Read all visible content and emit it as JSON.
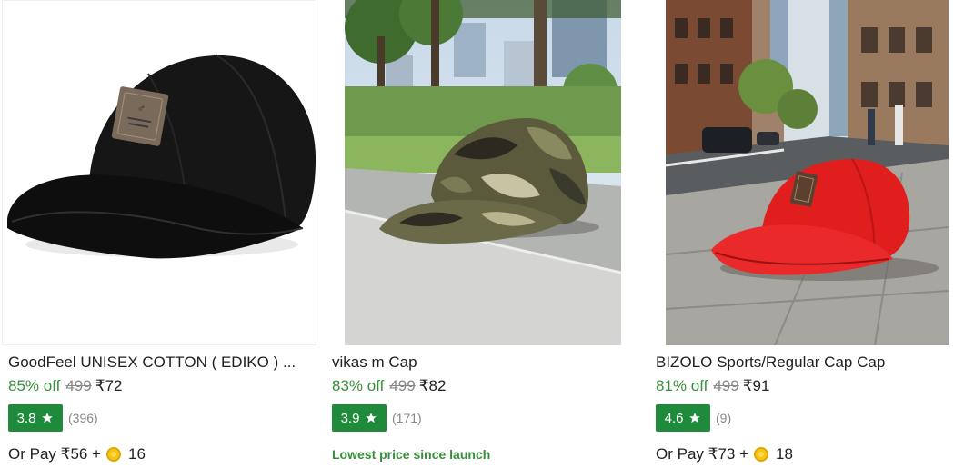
{
  "products": [
    {
      "title": "GoodFeel UNISEX COTTON ( EDIKO ) ...",
      "discount": "85% off",
      "mrp": "499",
      "price": "₹72",
      "rating": "3.8",
      "rating_count": "(396)",
      "pay_text": "Or Pay ₹56 +",
      "coins": "16",
      "image_icon": "black-cap-image"
    },
    {
      "title": "vikas m Cap",
      "discount": "83% off",
      "mrp": "499",
      "price": "₹82",
      "rating": "3.9",
      "rating_count": "(171)",
      "promo": "Lowest price since launch",
      "image_icon": "camo-cap-image"
    },
    {
      "title": "BIZOLO Sports/Regular Cap Cap",
      "discount": "81% off",
      "mrp": "499",
      "price": "₹91",
      "rating": "4.6",
      "rating_count": "(9)",
      "pay_text": "Or Pay ₹73 +",
      "coins": "18",
      "image_icon": "red-cap-image"
    }
  ],
  "colors": {
    "discount_green": "#388e3c",
    "rating_badge": "#1f8a3b",
    "muted": "#878787",
    "coin": "#f5c518"
  }
}
